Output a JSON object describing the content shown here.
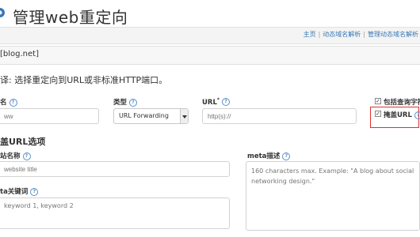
{
  "header": {
    "title": "管理web重定向",
    "title_icon": "gear-icon"
  },
  "breadcrumbs": [
    "主页",
    "动态域名解析",
    "管理动态域名解析"
  ],
  "domain_label": "[blog.net]",
  "instruction": "译: 选择重定向到URL或非标准HTTP端口。",
  "fields": {
    "subdomain": {
      "label": "名",
      "placeholder": "ww"
    },
    "type": {
      "label": "类型",
      "value": "URL Forwarding"
    },
    "url": {
      "label": "URL",
      "required_mark": "*",
      "placeholder": "http(s)://"
    },
    "include_query": {
      "label": "包括查询字符串",
      "checked": true
    },
    "mask_url": {
      "label": "掩盖URL",
      "checked": true
    }
  },
  "mask_section": {
    "title": "盖URL选项",
    "site_name": {
      "label": "站名称",
      "placeholder": "website title"
    },
    "meta_description": {
      "label": "meta描述",
      "placeholder": "160 characters max. Example: \"A blog about social networking design.\""
    },
    "meta_keywords": {
      "label": "ta关键词",
      "placeholder": "keyword 1, keyword 2"
    }
  },
  "colors": {
    "link": "#3a78b5",
    "highlight": "#e03030",
    "help_icon": "#5a8fc7"
  }
}
